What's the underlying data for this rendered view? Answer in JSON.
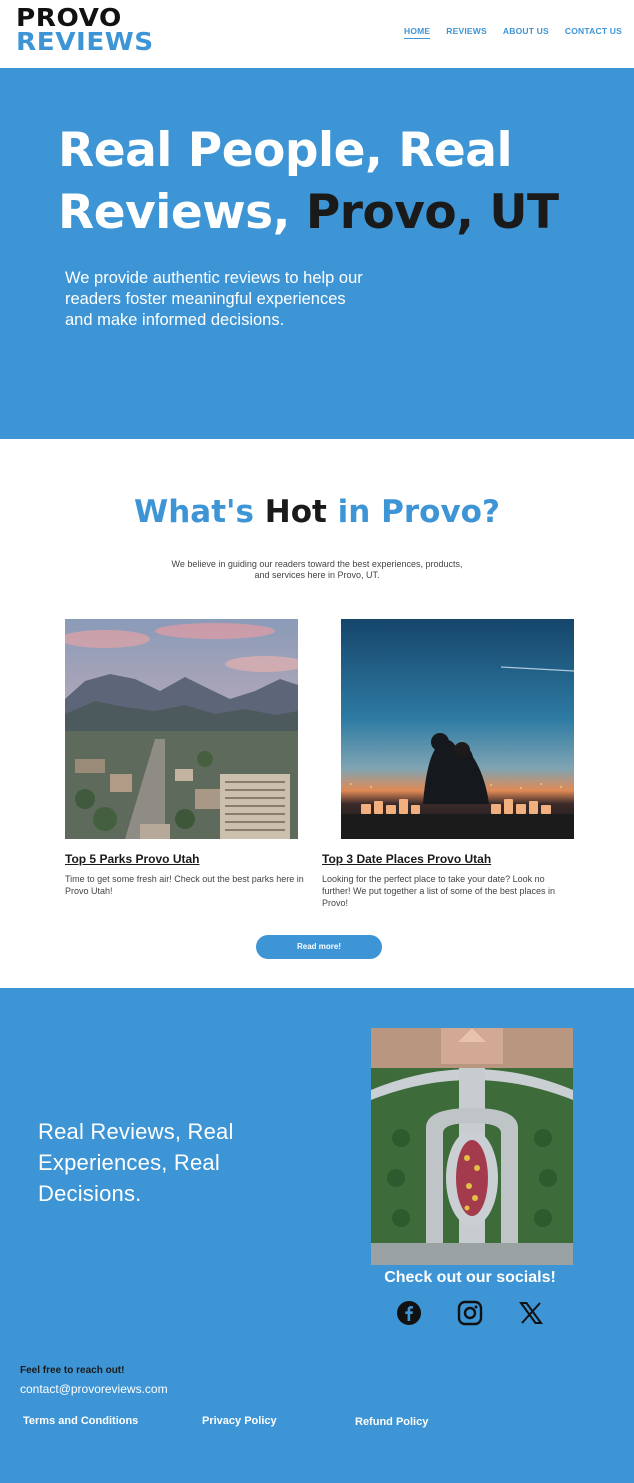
{
  "brand": {
    "logo_line1": "PROVO",
    "logo_line2": "REVIEWS"
  },
  "nav": [
    {
      "label": "HOME",
      "active": true
    },
    {
      "label": "REVIEWS",
      "active": false
    },
    {
      "label": "ABOUT US",
      "active": false
    },
    {
      "label": "CONTACT US",
      "active": false
    }
  ],
  "hero": {
    "title_light": "Real People, Real Reviews,",
    "title_dark": "Provo, UT",
    "subtitle": "We provide authentic reviews to help our readers foster meaningful experiences and make informed decisions."
  },
  "hot": {
    "title_part1": "What's",
    "title_part2": "Hot",
    "title_part3": "in Provo?",
    "subtitle": "We believe in guiding our readers toward the best experiences, products, and services here in Provo, UT."
  },
  "cards": [
    {
      "title": "Top 5 Parks Provo Utah",
      "text": "Time to get some fresh air! Check out the best parks here in Provo Utah!"
    },
    {
      "title": "Top 3 Date Places Provo Utah",
      "text": "Looking for the perfect place to take your date? Look no further! We put together a list of some of the best places in Provo!"
    }
  ],
  "read_more": "Read more!",
  "bottom": {
    "title": "Real Reviews, Real Experiences, Real Decisions.",
    "socials_title": "Check out our socials!",
    "socials": [
      "facebook-icon",
      "instagram-icon",
      "x-icon"
    ],
    "reach_out": "Feel free to reach out!",
    "email": "contact@provoreviews.com",
    "links": {
      "terms": "Terms and Conditions",
      "privacy": "Privacy Policy",
      "refund": "Refund Policy"
    }
  },
  "colors": {
    "brand_blue": "#3d95d6",
    "dark": "#1a1a1a",
    "white": "#ffffff"
  }
}
